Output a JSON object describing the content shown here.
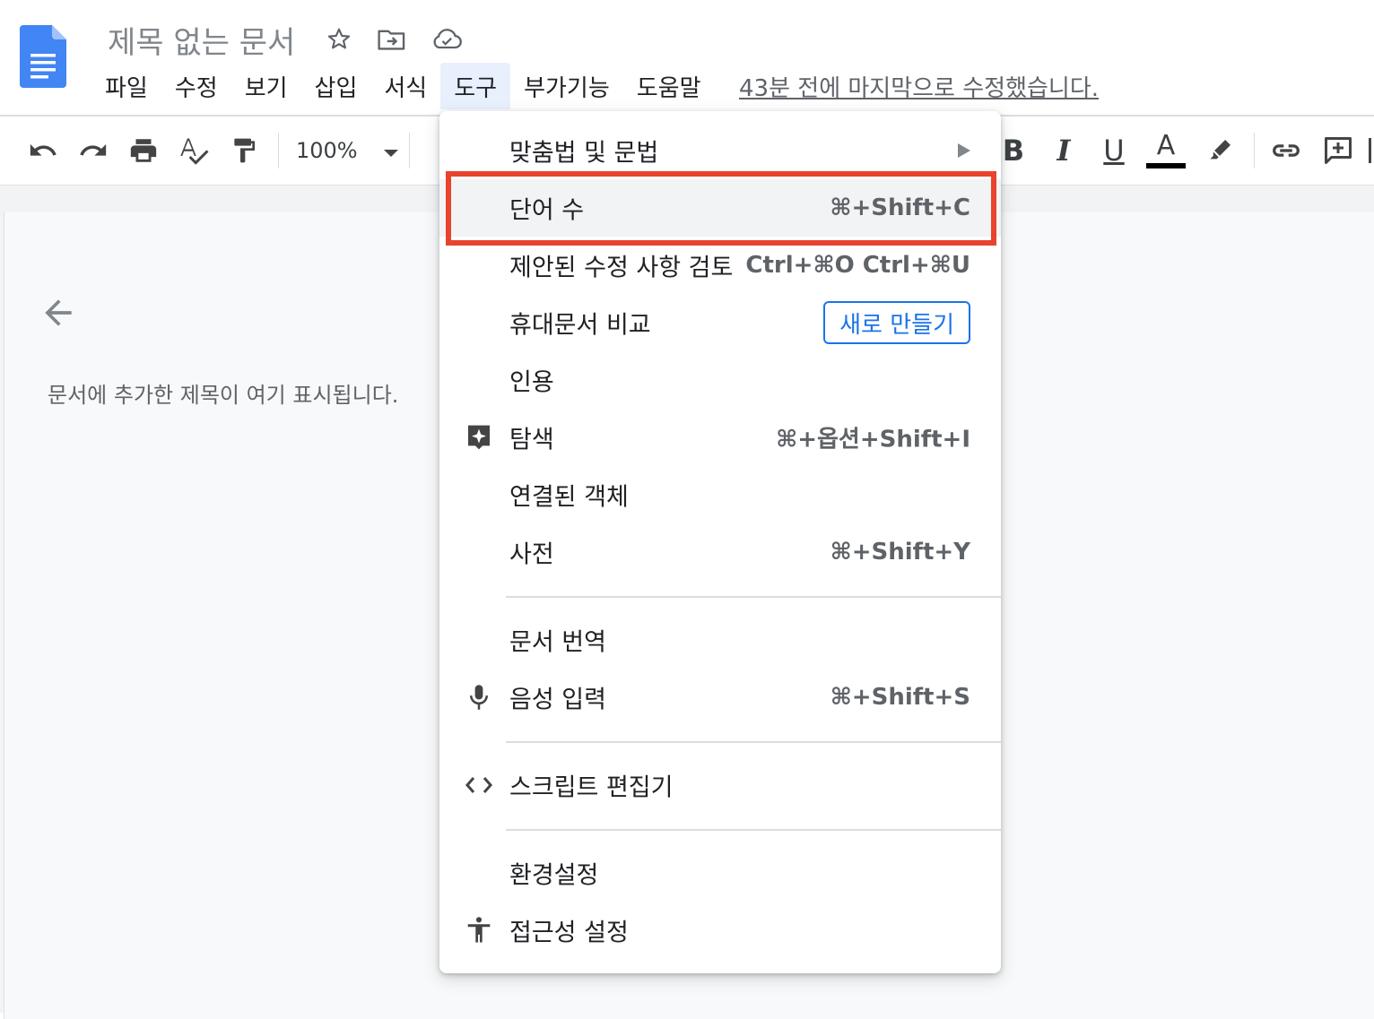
{
  "app": {
    "doc_title": "제목 없는 문서",
    "last_edit": "43분 전에 마지막으로 수정했습니다."
  },
  "menubar": {
    "items": [
      {
        "label": "파일"
      },
      {
        "label": "수정"
      },
      {
        "label": "보기"
      },
      {
        "label": "삽입"
      },
      {
        "label": "서식"
      },
      {
        "label": "도구",
        "active": true
      },
      {
        "label": "부가기능"
      },
      {
        "label": "도움말"
      }
    ]
  },
  "toolbar": {
    "zoom": "100%",
    "bold": "B",
    "italic": "I",
    "underline": "U",
    "text_color": "A"
  },
  "outline": {
    "hint": "문서에 추가한 제목이 여기 표시됩니다."
  },
  "tools_menu": {
    "items": [
      {
        "label": "맞춤법 및 문법",
        "submenu": true
      },
      {
        "label": "단어 수",
        "shortcut": "⌘+Shift+C",
        "highlighted": true
      },
      {
        "label": "제안된 수정 사항 검토",
        "shortcut": "Ctrl+⌘O Ctrl+⌘U"
      },
      {
        "label": "휴대문서 비교",
        "button": "새로 만들기"
      },
      {
        "label": "인용"
      },
      {
        "label": "탐색",
        "shortcut": "⌘+옵션+Shift+I",
        "icon": "explore-icon"
      },
      {
        "label": "연결된 객체"
      },
      {
        "label": "사전",
        "shortcut": "⌘+Shift+Y"
      },
      {
        "label": "문서 번역"
      },
      {
        "label": "음성 입력",
        "shortcut": "⌘+Shift+S",
        "icon": "microphone-icon"
      },
      {
        "label": "스크립트 편집기",
        "icon": "code-icon"
      },
      {
        "label": "환경설정"
      },
      {
        "label": "접근성 설정",
        "icon": "accessibility-icon"
      }
    ]
  },
  "colors": {
    "accent": "#1a73e8",
    "highlight_border": "#e8432e",
    "doc_blue": "#4285f4"
  }
}
